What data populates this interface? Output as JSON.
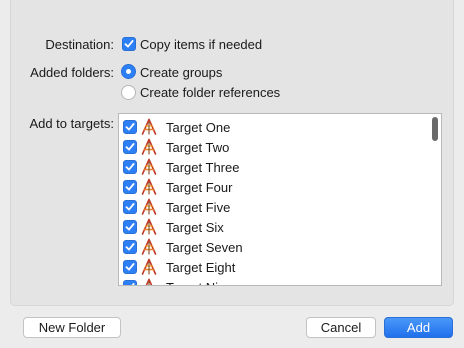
{
  "destination": {
    "label": "Destination:",
    "option_label": "Copy items if needed",
    "checked": true
  },
  "added_folders": {
    "label": "Added folders:",
    "options": [
      {
        "label": "Create groups",
        "selected": true
      },
      {
        "label": "Create folder references",
        "selected": false
      }
    ]
  },
  "targets": {
    "label": "Add to targets:",
    "items": [
      {
        "label": "Target One",
        "checked": true
      },
      {
        "label": "Target Two",
        "checked": true
      },
      {
        "label": "Target Three",
        "checked": true
      },
      {
        "label": "Target Four",
        "checked": true
      },
      {
        "label": "Target Five",
        "checked": true
      },
      {
        "label": "Target Six",
        "checked": true
      },
      {
        "label": "Target Seven",
        "checked": true
      },
      {
        "label": "Target Eight",
        "checked": true
      },
      {
        "label": "Target Nine",
        "checked": true
      }
    ],
    "icon": "application-icon"
  },
  "buttons": {
    "new_folder": "New Folder",
    "cancel": "Cancel",
    "add": "Add"
  },
  "colors": {
    "accent": "#2d7ff5",
    "background": "#ececec"
  }
}
